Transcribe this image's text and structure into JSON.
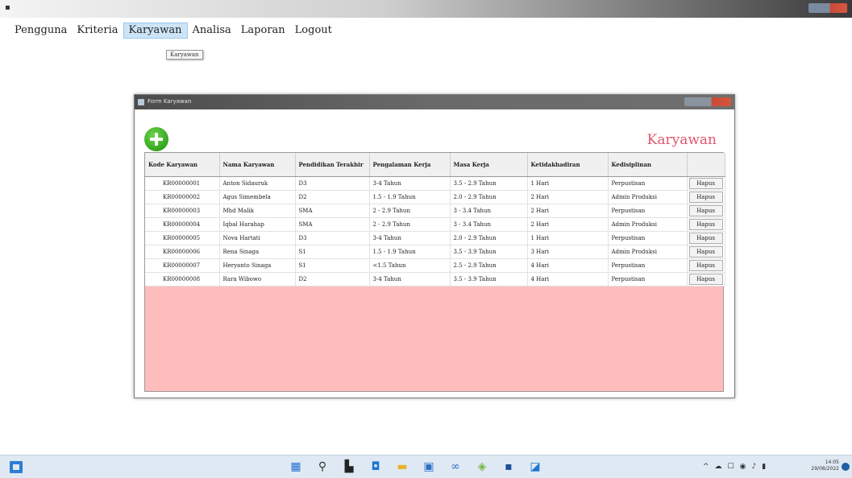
{
  "app": {
    "title_icon": "app-icon"
  },
  "menu": {
    "items": [
      {
        "label": "Pengguna",
        "active": false
      },
      {
        "label": "Kriteria",
        "active": false
      },
      {
        "label": "Karyawan",
        "active": true
      },
      {
        "label": "Analisa",
        "active": false
      },
      {
        "label": "Laporan",
        "active": false
      },
      {
        "label": "Logout",
        "active": false
      }
    ],
    "tooltip": "Karyawan"
  },
  "dialog": {
    "title": "Form Karyawan",
    "heading": "Karyawan",
    "heading_color": "#e0566b",
    "add_icon": "plus-circle-icon",
    "columns": [
      "Kode Karyawan",
      "Nama Karyawan",
      "Pendidikan Terakhir",
      "Pengalaman Kerja",
      "Masa Kerja",
      "Ketidakhadiran",
      "Kedisiplinan",
      ""
    ],
    "rows": [
      {
        "kode": "KR00000001",
        "nama": "Anton Sidauruk",
        "pendidikan": "D3",
        "pengalaman": "3-4 Tahun",
        "masa": "3.5 - 2.9 Tahun",
        "ketidakhadiran": "1 Hari",
        "kedisiplinan": "Perpustisan",
        "action": "Hapus"
      },
      {
        "kode": "KR00000002",
        "nama": "Agus Simembela",
        "pendidikan": "D2",
        "pengalaman": "1.5 - 1.9 Tahun",
        "masa": "2.0 - 2.9 Tahun",
        "ketidakhadiran": "2 Hari",
        "kedisiplinan": "Admin Produksi",
        "action": "Hapus"
      },
      {
        "kode": "KR00000003",
        "nama": "Mhd Malik",
        "pendidikan": "SMA",
        "pengalaman": "2 - 2.9 Tahun",
        "masa": "3 - 3.4 Tahun",
        "ketidakhadiran": "2 Hari",
        "kedisiplinan": "Perpustisan",
        "action": "Hapus"
      },
      {
        "kode": "KR00000004",
        "nama": "Iqbal Harahap",
        "pendidikan": "SMA",
        "pengalaman": "2 - 2.9 Tahun",
        "masa": "3 - 3.4 Tahun",
        "ketidakhadiran": "2 Hari",
        "kedisiplinan": "Admin Produksi",
        "action": "Hapus"
      },
      {
        "kode": "KR00000005",
        "nama": "Nova Hartati",
        "pendidikan": "D3",
        "pengalaman": "3-4 Tahun",
        "masa": "2.0 - 2.9 Tahun",
        "ketidakhadiran": "1 Hari",
        "kedisiplinan": "Perpustisan",
        "action": "Hapus"
      },
      {
        "kode": "KR00000006",
        "nama": "Rena Sinaga",
        "pendidikan": "S1",
        "pengalaman": "1.5 - 1.9 Tahun",
        "masa": "3.5 - 3.9 Tahun",
        "ketidakhadiran": "3 Hari",
        "kedisiplinan": "Admin Produksi",
        "action": "Hapus"
      },
      {
        "kode": "KR00000007",
        "nama": "Heryanto Sinaga",
        "pendidikan": "S1",
        "pengalaman": "<1.5 Tahun",
        "masa": "2.5 - 2.9 Tahun",
        "ketidakhadiran": "4 Hari",
        "kedisiplinan": "Perpustisan",
        "action": "Hapus"
      },
      {
        "kode": "KR00000008",
        "nama": "Rara Wibowo",
        "pendidikan": "D2",
        "pengalaman": "3-4 Tahun",
        "masa": "3.5 - 3.9 Tahun",
        "ketidakhadiran": "4 Hari",
        "kedisiplinan": "Perpustisan",
        "action": "Hapus"
      }
    ]
  },
  "taskbar": {
    "start_icon": "windows-start-icon",
    "icons": [
      {
        "name": "windows-icon",
        "glyph": "▦",
        "color": "#1f6fd0"
      },
      {
        "name": "search-icon",
        "glyph": "⚲",
        "color": "#333333"
      },
      {
        "name": "widgets-icon",
        "glyph": "▙",
        "color": "#222222"
      },
      {
        "name": "chat-icon",
        "glyph": "◘",
        "color": "#1f77d0"
      },
      {
        "name": "file-explorer-icon",
        "glyph": "▬",
        "color": "#e8b32a"
      },
      {
        "name": "store-icon",
        "glyph": "▣",
        "color": "#2b6fc7"
      },
      {
        "name": "app-icon-infinity",
        "glyph": "∞",
        "color": "#2b6fc7"
      },
      {
        "name": "app-icon-green",
        "glyph": "◈",
        "color": "#7ab648"
      },
      {
        "name": "app-icon-blue",
        "glyph": "▪",
        "color": "#1d4f9a"
      },
      {
        "name": "app-icon-window",
        "glyph": "◪",
        "color": "#1f77d0"
      }
    ],
    "tray": [
      "^",
      "☁",
      "☐",
      "◉",
      "♪",
      "▮"
    ],
    "time": "14:05",
    "date": "29/08/2022"
  }
}
